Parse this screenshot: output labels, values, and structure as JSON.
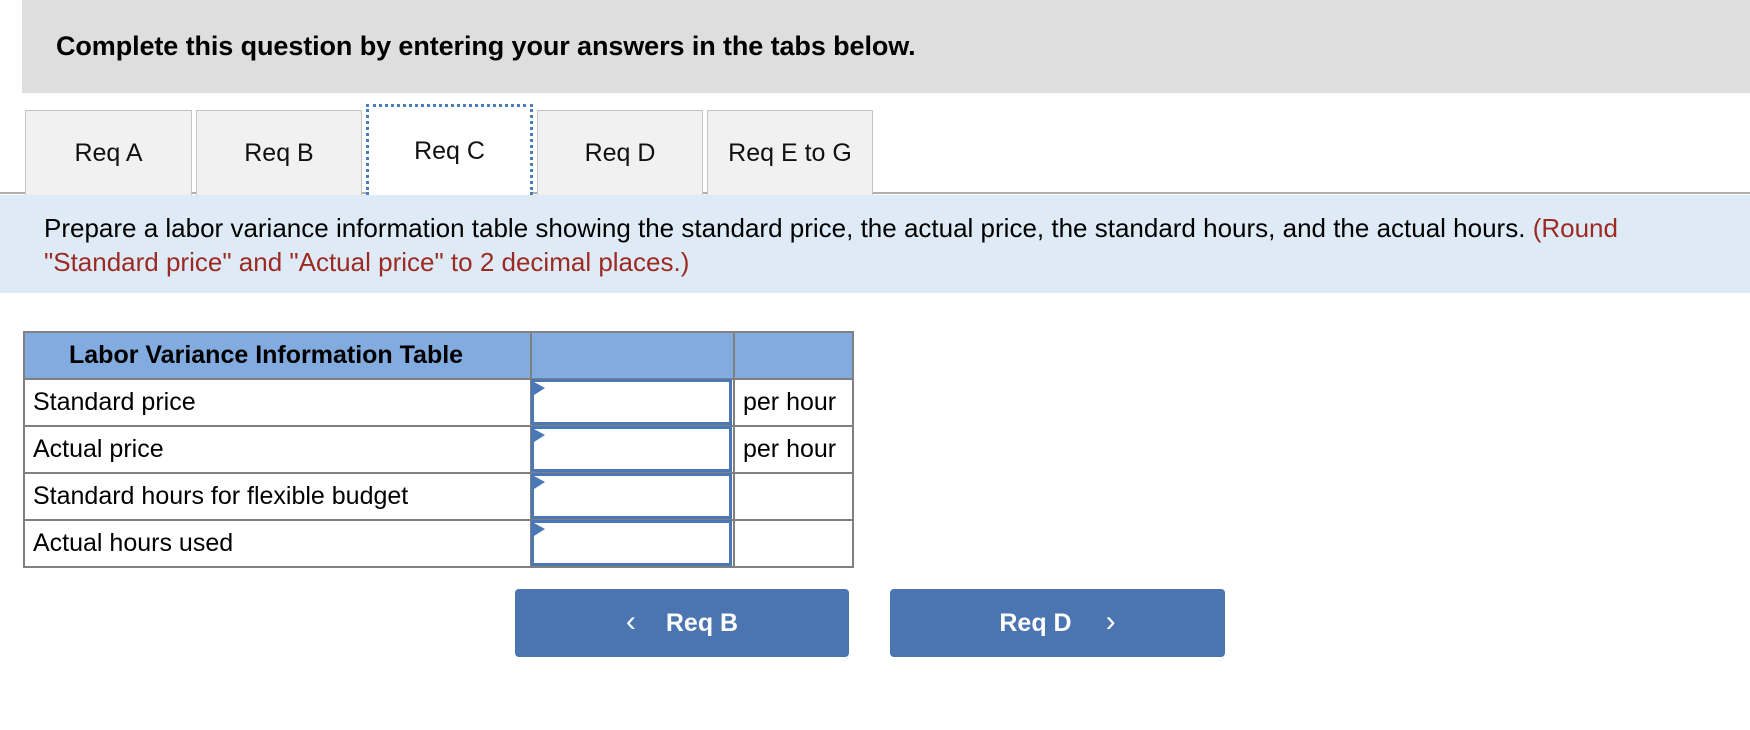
{
  "header": {
    "title": "Complete this question by entering your answers in the tabs below."
  },
  "tabs": {
    "items": [
      {
        "label": "Req A",
        "selected": false
      },
      {
        "label": "Req B",
        "selected": false
      },
      {
        "label": "Req C",
        "selected": true
      },
      {
        "label": "Req D",
        "selected": false
      },
      {
        "label": "Req E to G",
        "selected": false
      }
    ]
  },
  "requirement": {
    "text": "Prepare a labor variance information table showing the standard price, the actual price, the standard hours, and the actual hours.",
    "hint": "(Round \"Standard price\" and \"Actual price\" to 2 decimal places.)"
  },
  "table": {
    "title": "Labor Variance Information Table",
    "header_extra_1": "",
    "header_extra_2": "",
    "rows": [
      {
        "label": "Standard price",
        "value": "",
        "unit": "per hour"
      },
      {
        "label": "Actual price",
        "value": "",
        "unit": "per hour"
      },
      {
        "label": "Standard hours for flexible budget",
        "value": "",
        "unit": ""
      },
      {
        "label": "Actual hours used",
        "value": "",
        "unit": ""
      }
    ]
  },
  "nav": {
    "prev_label": "Req B",
    "prev_icon": "chevron-left-icon",
    "next_label": "Req D",
    "next_icon": "chevron-right-icon"
  },
  "colors": {
    "header_banner": "#dedede",
    "requirement_banner": "#deebf7",
    "hint_text": "#9c2a22",
    "table_header": "#82abdf",
    "input_border": "#4a77b5",
    "button": "#4a75b0",
    "tab_selected_border": "#4a7ebb"
  }
}
